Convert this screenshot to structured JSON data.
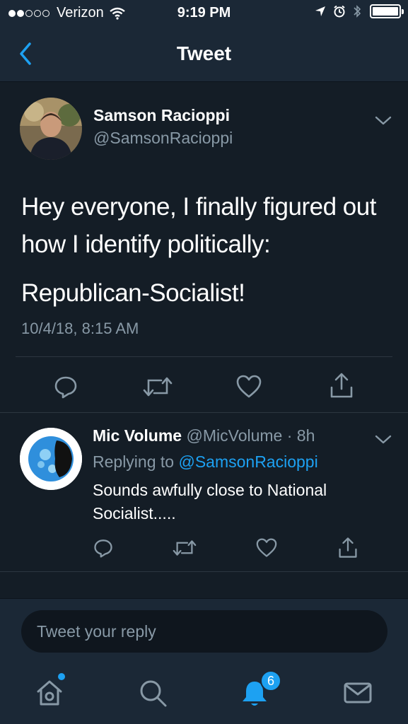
{
  "status_bar": {
    "carrier": "Verizon",
    "time": "9:19 PM",
    "signal_icon": "signal-dots-icon",
    "wifi_icon": "wifi-icon",
    "location_icon": "location-arrow-icon",
    "alarm_icon": "alarm-clock-icon",
    "bluetooth_icon": "bluetooth-icon",
    "battery_icon": "battery-icon"
  },
  "nav": {
    "title": "Tweet",
    "back_icon": "chevron-left-icon"
  },
  "main_tweet": {
    "author_name": "Samson Racioppi",
    "author_handle": "@SamsonRacioppi",
    "text_line1": "Hey everyone, I finally figured out how I identify politically:",
    "text_line2": "Republican-Socialist!",
    "timestamp": "10/4/18, 8:15 AM",
    "actions": [
      "reply-icon",
      "retweet-icon",
      "like-icon",
      "share-icon"
    ]
  },
  "reply": {
    "author_name": "Mic Volume",
    "author_handle": "@MicVolume",
    "separator": "·",
    "age": "8h",
    "replying_prefix": "Replying to",
    "replying_to": "@SamsonRacioppi",
    "text": "Sounds awfully close to National Socialist.....",
    "actions": [
      "reply-icon",
      "retweet-icon",
      "like-icon",
      "share-icon"
    ]
  },
  "compose": {
    "placeholder": "Tweet your reply"
  },
  "tab_bar": {
    "tabs": [
      "home-icon",
      "search-icon",
      "notifications-bell-icon",
      "messages-icon"
    ],
    "notifications_badge": "6"
  },
  "colors": {
    "background": "#141d26",
    "bar_background": "#1b2836",
    "accent": "#1da1f2",
    "secondary_text": "#8899a6"
  }
}
